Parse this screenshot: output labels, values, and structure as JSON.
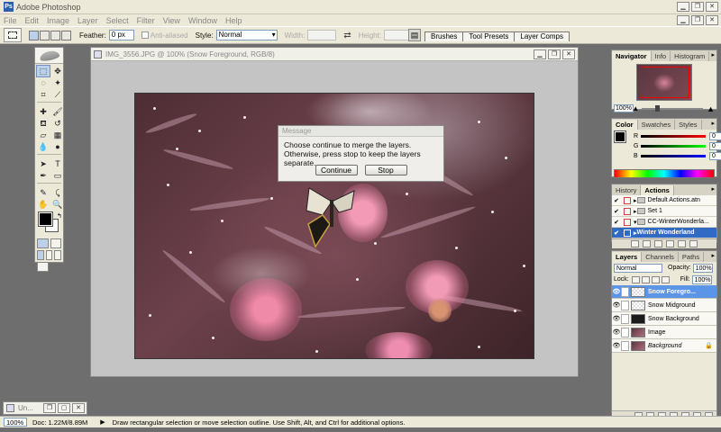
{
  "app": {
    "title": "Adobe Photoshop"
  },
  "menu": [
    "File",
    "Edit",
    "Image",
    "Layer",
    "Select",
    "Filter",
    "View",
    "Window",
    "Help"
  ],
  "options": {
    "feather_label": "Feather:",
    "feather_value": "0 px",
    "antialiased_label": "Anti-aliased",
    "style_label": "Style:",
    "style_value": "Normal",
    "width_label": "Width:",
    "height_label": "Height:"
  },
  "palette_well": [
    "Brushes",
    "Tool Presets",
    "Layer Comps"
  ],
  "document": {
    "title": "IMG_3556.JPG @ 100% (Snow Foreground, RGB/8)"
  },
  "dialog": {
    "title": "Message",
    "message": "Choose continue to merge the layers. Otherwise, press stop to keep the layers separate.",
    "continue_label": "Continue",
    "stop_label": "Stop"
  },
  "navigator": {
    "tabs": [
      "Navigator",
      "Info",
      "Histogram"
    ],
    "zoom": "100%"
  },
  "color_panel": {
    "tabs": [
      "Color",
      "Swatches",
      "Styles"
    ],
    "r": "0",
    "g": "0",
    "b": "0"
  },
  "actions_panel": {
    "tabs": [
      "History",
      "Actions"
    ],
    "items": [
      {
        "label": "Default Actions.atn",
        "checked": "✔"
      },
      {
        "label": "Set 1",
        "checked": "✔"
      },
      {
        "label": "CC-WinterWonderla...",
        "checked": "✔"
      },
      {
        "label": "Winter Wonderland",
        "checked": "✔"
      }
    ]
  },
  "layers_panel": {
    "tabs": [
      "Layers",
      "Channels",
      "Paths"
    ],
    "blend_mode": "Normal",
    "opacity_label": "Opacity:",
    "opacity_value": "100%",
    "lock_label": "Lock:",
    "fill_label": "Fill:",
    "fill_value": "100%",
    "layers": [
      {
        "name": "Snow Foregro...",
        "eye": "👁"
      },
      {
        "name": "Snow Midground",
        "eye": "👁"
      },
      {
        "name": "Snow Background",
        "eye": "👁"
      },
      {
        "name": "Image",
        "eye": "👁"
      },
      {
        "name": "Background",
        "eye": "👁"
      }
    ]
  },
  "minimized_window": {
    "label": "Un..."
  },
  "status": {
    "zoom": "100%",
    "doc": "Doc: 1.22M/8.89M",
    "hint": "Draw rectangular selection or move selection outline.  Use Shift, Alt, and Ctrl for additional options."
  },
  "colors": {
    "selection_blue": "#316ac5",
    "layer_highlight": "#5b95e8",
    "workspace_gray": "#6e6e6e"
  }
}
